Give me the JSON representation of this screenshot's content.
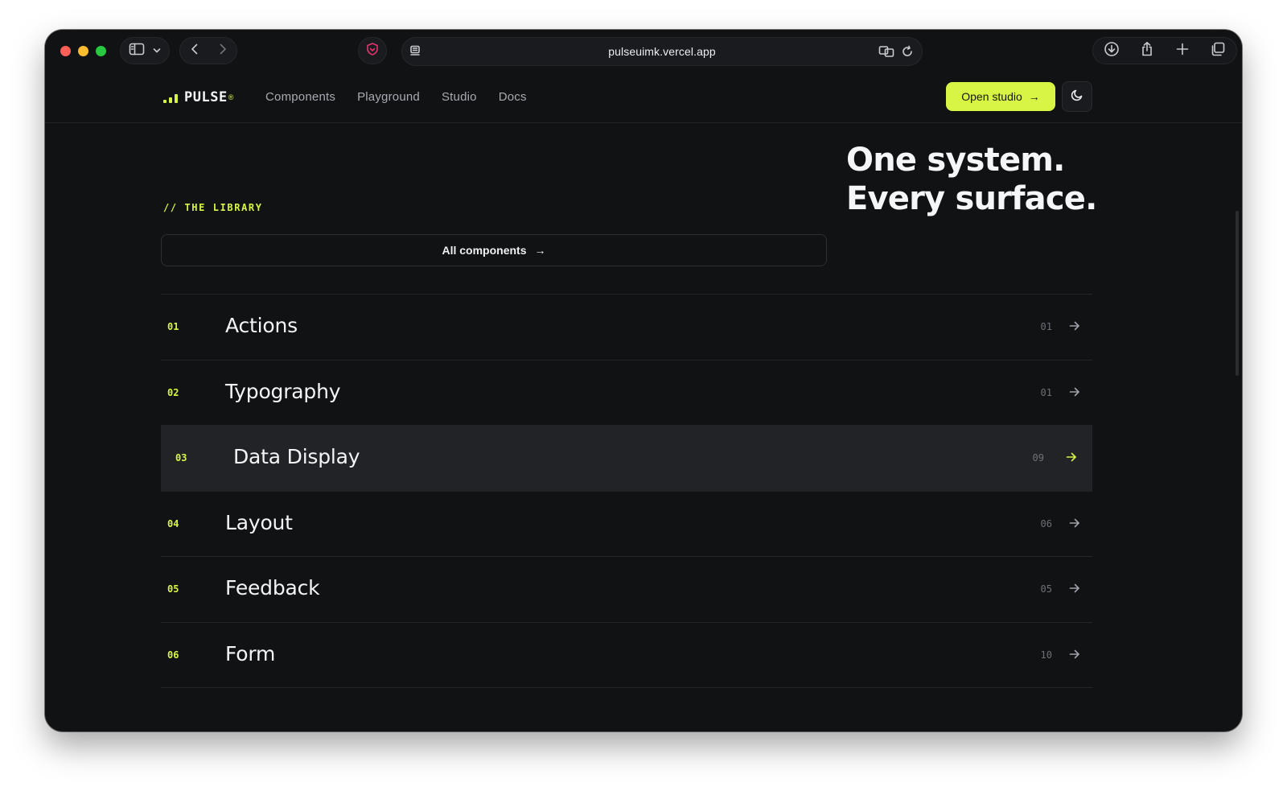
{
  "browser": {
    "url": "pulseuimk.vercel.app"
  },
  "nav": {
    "logo": "PULSE",
    "logo_mark": "®",
    "links": [
      "Components",
      "Playground",
      "Studio",
      "Docs"
    ],
    "cta_label": "Open studio",
    "cta_arrow": "→"
  },
  "hero": {
    "eyebrow": "// THE LIBRARY",
    "headline_line1": "One system.",
    "headline_line2": "Every surface.",
    "all_components_label": "All components",
    "all_components_arrow": "→"
  },
  "categories": [
    {
      "num": "01",
      "name": "Actions",
      "count": "01"
    },
    {
      "num": "02",
      "name": "Typography",
      "count": "01"
    },
    {
      "num": "03",
      "name": "Data Display",
      "count": "09",
      "active": true
    },
    {
      "num": "04",
      "name": "Layout",
      "count": "06"
    },
    {
      "num": "05",
      "name": "Feedback",
      "count": "05"
    },
    {
      "num": "06",
      "name": "Form",
      "count": "10"
    }
  ],
  "colors": {
    "accent": "#d8f545",
    "background": "#111214",
    "active_row": "#212327"
  },
  "icons": [
    "sidebar-icon",
    "chevron-down-icon",
    "back-icon",
    "forward-icon",
    "shield-icon",
    "reader-icon",
    "translate-icon",
    "reload-icon",
    "download-icon",
    "share-icon",
    "plus-icon",
    "tabs-icon",
    "moon-icon",
    "arrow-right-icon"
  ]
}
